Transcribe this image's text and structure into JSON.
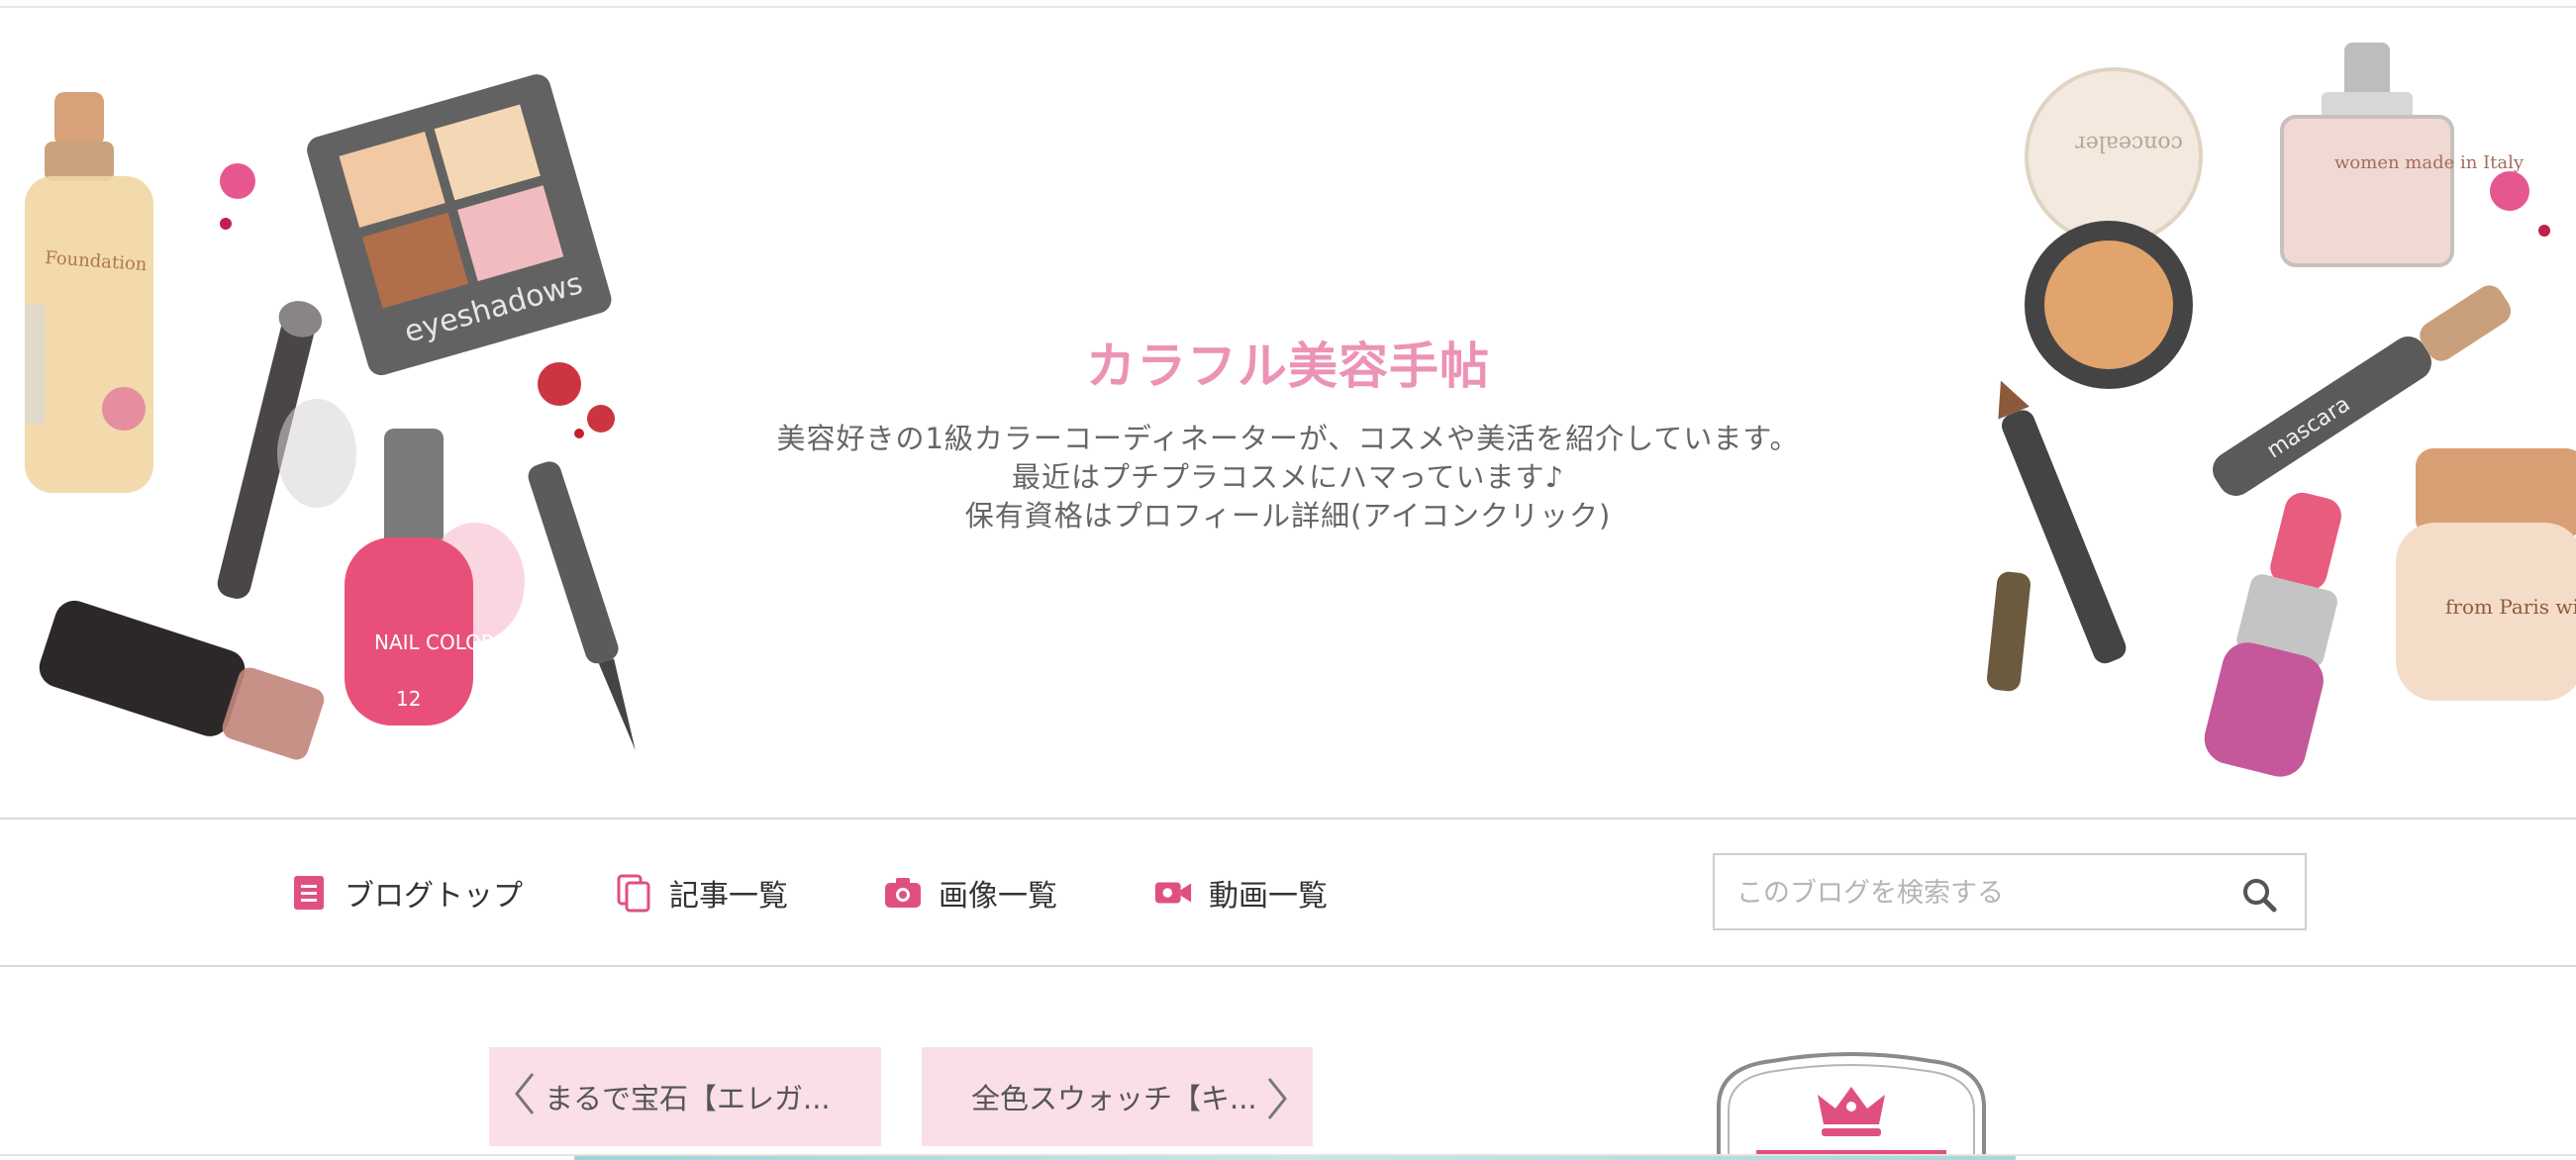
{
  "header": {
    "title": "カラフル美容手帖",
    "description": [
      "美容好きの1級カラーコーディネーターが、コスメや美活を紹介しています。",
      "最近はプチプラコスメにハマっています♪",
      "保有資格はプロフィール詳細(アイコンクリック)"
    ],
    "illustration_labels": {
      "eyeshadow": "eyeshadows",
      "nail": "NAIL COLOR",
      "nail_number": "12",
      "foundation": "Foundation",
      "concealer": "concealer",
      "perfume": "women made in Italy",
      "mascara": "mascara",
      "cream": "from Paris with Love"
    }
  },
  "nav": {
    "items": [
      {
        "label": "ブログトップ",
        "icon": "document-icon"
      },
      {
        "label": "記事一覧",
        "icon": "copy-icon"
      },
      {
        "label": "画像一覧",
        "icon": "camera-icon"
      },
      {
        "label": "動画一覧",
        "icon": "video-icon"
      }
    ],
    "search": {
      "placeholder": "このブログを検索する",
      "value": ""
    }
  },
  "pager": {
    "prev_label": "まるで宝石【エレガ...",
    "next_label": "全色スウォッチ【キ..."
  },
  "colors": {
    "accent": "#ec93b5",
    "icon_pink": "#e0507f",
    "pager_bg": "#fadfe6"
  }
}
